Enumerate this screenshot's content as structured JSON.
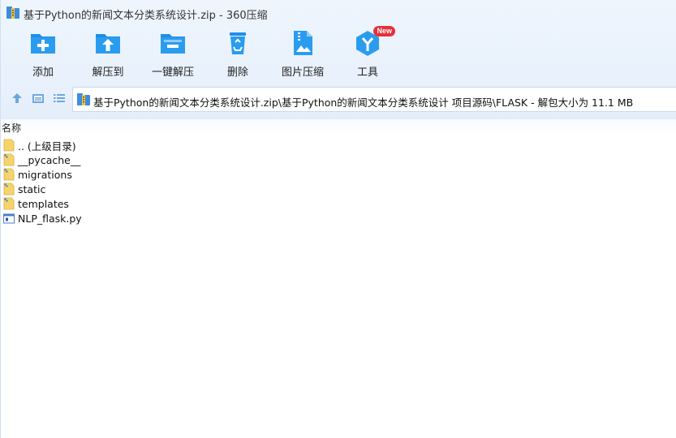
{
  "window": {
    "title": "基于Python的新闻文本分类系统设计.zip - 360压缩"
  },
  "toolbar": {
    "buttons": [
      {
        "id": "add",
        "label": "添加",
        "icon": "folder-add-icon"
      },
      {
        "id": "extract-to",
        "label": "解压到",
        "icon": "folder-upload-icon"
      },
      {
        "id": "one-click-extract",
        "label": "一键解压",
        "icon": "folder-minus-icon"
      },
      {
        "id": "delete",
        "label": "删除",
        "icon": "recycle-bin-icon"
      },
      {
        "id": "image-compress",
        "label": "图片压缩",
        "icon": "image-zip-icon"
      },
      {
        "id": "tools",
        "label": "工具",
        "icon": "tools-cube-icon",
        "badge": "New"
      }
    ]
  },
  "navbar": {
    "path": "基于Python的新闻文本分类系统设计.zip\\基于Python的新闻文本分类系统设计 项目源码\\FLASK - 解包大小为 11.1 MB"
  },
  "list": {
    "column_name": "名称",
    "items": [
      {
        "label": ".. (上级目录)",
        "type": "folder"
      },
      {
        "label": "__pycache__",
        "type": "folder-zip"
      },
      {
        "label": "migrations",
        "type": "folder-zip"
      },
      {
        "label": "static",
        "type": "folder-zip"
      },
      {
        "label": "templates",
        "type": "folder-zip"
      },
      {
        "label": "NLP_flask.py",
        "type": "file-py"
      }
    ]
  },
  "colors": {
    "accent_blue": "#1a8fe8",
    "badge_red": "#e8303a",
    "folder_yellow": "#f7d46b",
    "chrome_bg": "#eaf2fc"
  }
}
